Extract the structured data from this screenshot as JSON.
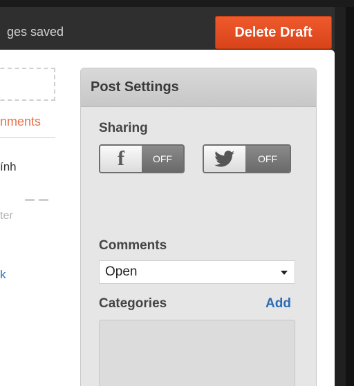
{
  "topbar": {
    "status": "ges saved",
    "delete_draft_label": "Delete Draft"
  },
  "left": {
    "comments_link": "nments",
    "name": "ính",
    "hint": "ter",
    "link": "k"
  },
  "post_settings": {
    "title": "Post Settings",
    "sharing_label": "Sharing",
    "facebook_toggle": {
      "icon": "facebook-icon",
      "state": "OFF"
    },
    "twitter_toggle": {
      "icon": "twitter-bird-icon",
      "state": "OFF"
    },
    "comments_label": "Comments",
    "comments_value": "Open",
    "categories_label": "Categories",
    "categories_add": "Add"
  },
  "colors": {
    "delete_button": "#e44c22",
    "link_blue": "#2a6db5",
    "comments_orange": "#e9714a"
  }
}
